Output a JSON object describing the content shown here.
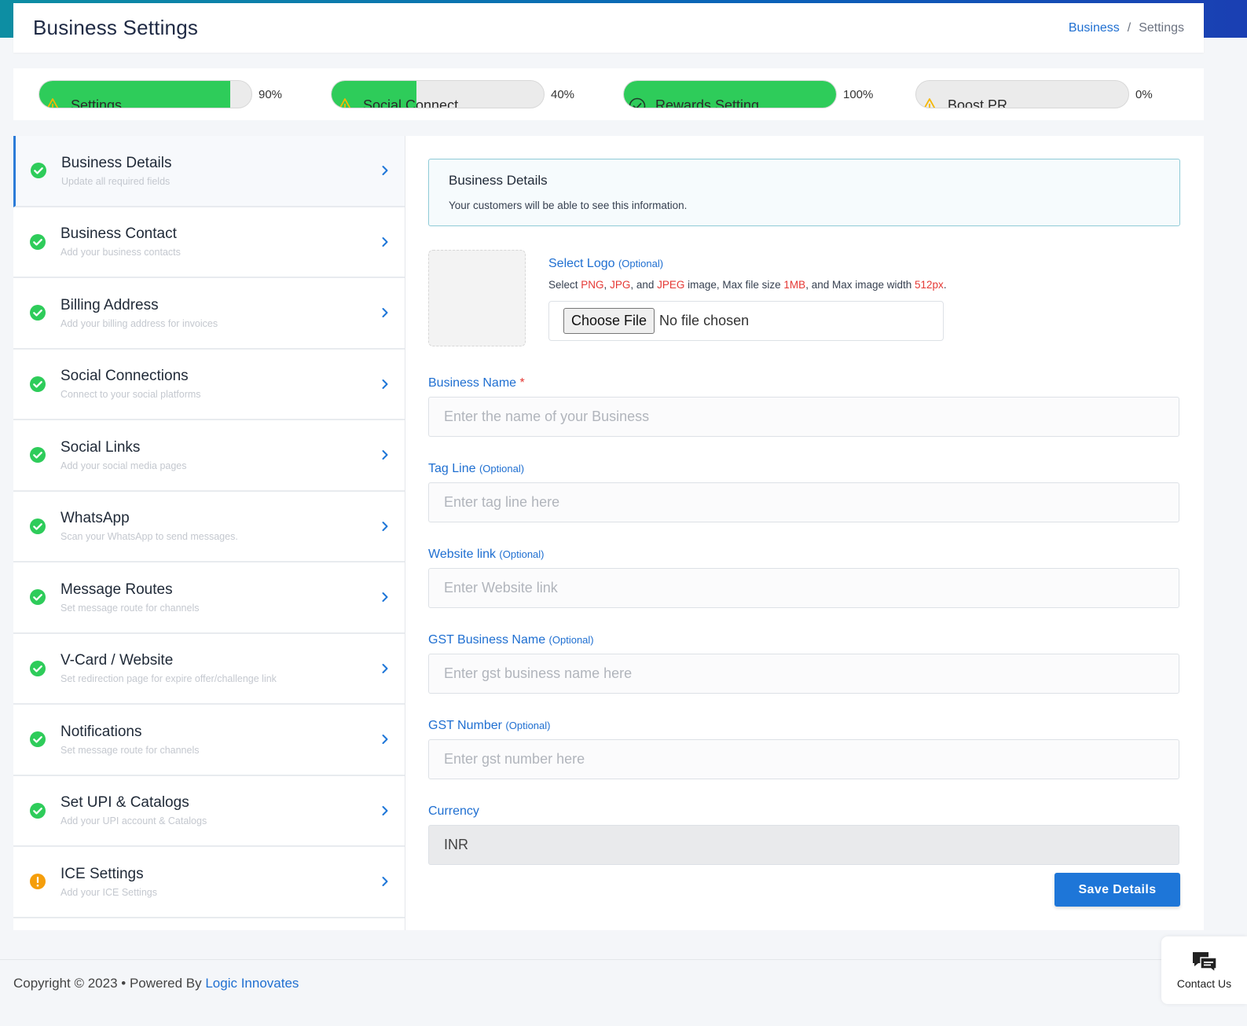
{
  "header": {
    "title": "Business Settings",
    "breadcrumb_link": "Business",
    "breadcrumb_sep": "/",
    "breadcrumb_current": "Settings"
  },
  "progress": [
    {
      "label": "Settings",
      "percent": 90,
      "percent_text": "90%",
      "icon": "warning-icon"
    },
    {
      "label": "Social Connect",
      "percent": 40,
      "percent_text": "40%",
      "icon": "warning-icon"
    },
    {
      "label": "Rewards Setting",
      "percent": 100,
      "percent_text": "100%",
      "icon": "check-circle-icon"
    },
    {
      "label": "Boost PR",
      "percent": 0,
      "percent_text": "0%",
      "icon": "warning-icon"
    }
  ],
  "sidebar": {
    "items": [
      {
        "title": "Business Details",
        "sub": "Update all required fields",
        "status": "complete"
      },
      {
        "title": "Business Contact",
        "sub": "Add your business contacts",
        "status": "complete"
      },
      {
        "title": "Billing Address",
        "sub": "Add your billing address for invoices",
        "status": "complete"
      },
      {
        "title": "Social Connections",
        "sub": "Connect to your social platforms",
        "status": "complete"
      },
      {
        "title": "Social Links",
        "sub": "Add your social media pages",
        "status": "complete"
      },
      {
        "title": "WhatsApp",
        "sub": "Scan your WhatsApp to send messages.",
        "status": "complete"
      },
      {
        "title": "Message Routes",
        "sub": "Set message route for channels",
        "status": "complete"
      },
      {
        "title": "V-Card / Website",
        "sub": "Set redirection page for expire offer/challenge link",
        "status": "complete"
      },
      {
        "title": "Notifications",
        "sub": "Set message route for channels",
        "status": "complete"
      },
      {
        "title": "Set UPI & Catalogs",
        "sub": "Add your UPI account & Catalogs",
        "status": "complete"
      },
      {
        "title": "ICE Settings",
        "sub": "Add your ICE Settings",
        "status": "warning"
      }
    ]
  },
  "info": {
    "title": "Business Details",
    "subtitle": "Your customers will be able to see this information."
  },
  "logo": {
    "label": "Select Logo",
    "optional": "(Optional)",
    "hint_parts": [
      "Select ",
      "PNG",
      ", ",
      "JPG",
      ", and ",
      "JPEG",
      " image, Max file size ",
      "1MB",
      ", and Max image width ",
      "512px",
      "."
    ],
    "choose_button": "Choose File",
    "no_file": "No file chosen"
  },
  "form": {
    "business_name": {
      "label": "Business Name",
      "required_mark": "*",
      "placeholder": "Enter the name of your Business"
    },
    "tag_line": {
      "label": "Tag Line",
      "optional": "(Optional)",
      "placeholder": "Enter tag line here"
    },
    "website": {
      "label": "Website link",
      "optional": "(Optional)",
      "placeholder": "Enter Website link"
    },
    "gst_name": {
      "label": "GST Business Name",
      "optional": "(Optional)",
      "placeholder": "Enter gst business name here"
    },
    "gst_number": {
      "label": "GST Number",
      "optional": "(Optional)",
      "placeholder": "Enter gst number here"
    },
    "currency": {
      "label": "Currency",
      "value": "INR"
    },
    "save_label": "Save Details"
  },
  "footer": {
    "copyright": "Copyright © 2023  • Powered By ",
    "company": "Logic Innovates"
  },
  "contact": {
    "label": "Contact Us"
  },
  "colors": {
    "accent": "#1e76d8",
    "success": "#2ecc5a",
    "warning": "#f59e0b"
  }
}
